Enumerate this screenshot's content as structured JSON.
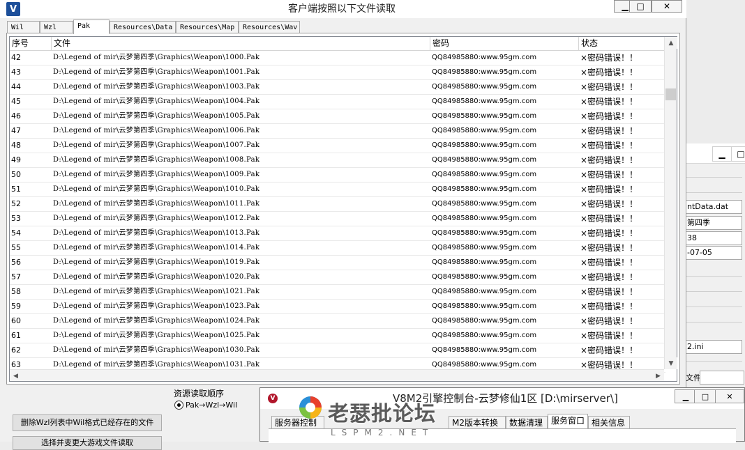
{
  "main_window": {
    "title": "客户端按照以下文件读取",
    "app_icon": "V",
    "controls": {
      "minimize": "▁",
      "maximize": "□",
      "close": "✕"
    }
  },
  "tabs": [
    {
      "label": "Wil"
    },
    {
      "label": "Wzl"
    },
    {
      "label": "Pak",
      "active": true
    },
    {
      "label": "Resources\\Data"
    },
    {
      "label": "Resources\\Map"
    },
    {
      "label": "Resources\\Wav"
    }
  ],
  "table": {
    "columns": [
      "序号",
      "文件",
      "密码",
      "状态"
    ],
    "rows": [
      {
        "no": "42",
        "file": "D:\\Legend of mir\\云梦第四季\\Graphics\\Weapon\\1000.Pak",
        "password": "QQ84985880:www.95gm.com",
        "status": "×密码错误！！"
      },
      {
        "no": "43",
        "file": "D:\\Legend of mir\\云梦第四季\\Graphics\\Weapon\\1001.Pak",
        "password": "QQ84985880:www.95gm.com",
        "status": "×密码错误！！"
      },
      {
        "no": "44",
        "file": "D:\\Legend of mir\\云梦第四季\\Graphics\\Weapon\\1003.Pak",
        "password": "QQ84985880:www.95gm.com",
        "status": "×密码错误！！"
      },
      {
        "no": "45",
        "file": "D:\\Legend of mir\\云梦第四季\\Graphics\\Weapon\\1004.Pak",
        "password": "QQ84985880:www.95gm.com",
        "status": "×密码错误！！"
      },
      {
        "no": "46",
        "file": "D:\\Legend of mir\\云梦第四季\\Graphics\\Weapon\\1005.Pak",
        "password": "QQ84985880:www.95gm.com",
        "status": "×密码错误！！"
      },
      {
        "no": "47",
        "file": "D:\\Legend of mir\\云梦第四季\\Graphics\\Weapon\\1006.Pak",
        "password": "QQ84985880:www.95gm.com",
        "status": "×密码错误！！"
      },
      {
        "no": "48",
        "file": "D:\\Legend of mir\\云梦第四季\\Graphics\\Weapon\\1007.Pak",
        "password": "QQ84985880:www.95gm.com",
        "status": "×密码错误！！"
      },
      {
        "no": "49",
        "file": "D:\\Legend of mir\\云梦第四季\\Graphics\\Weapon\\1008.Pak",
        "password": "QQ84985880:www.95gm.com",
        "status": "×密码错误！！"
      },
      {
        "no": "50",
        "file": "D:\\Legend of mir\\云梦第四季\\Graphics\\Weapon\\1009.Pak",
        "password": "QQ84985880:www.95gm.com",
        "status": "×密码错误！！"
      },
      {
        "no": "51",
        "file": "D:\\Legend of mir\\云梦第四季\\Graphics\\Weapon\\1010.Pak",
        "password": "QQ84985880:www.95gm.com",
        "status": "×密码错误！！"
      },
      {
        "no": "52",
        "file": "D:\\Legend of mir\\云梦第四季\\Graphics\\Weapon\\1011.Pak",
        "password": "QQ84985880:www.95gm.com",
        "status": "×密码错误！！"
      },
      {
        "no": "53",
        "file": "D:\\Legend of mir\\云梦第四季\\Graphics\\Weapon\\1012.Pak",
        "password": "QQ84985880:www.95gm.com",
        "status": "×密码错误！！"
      },
      {
        "no": "54",
        "file": "D:\\Legend of mir\\云梦第四季\\Graphics\\Weapon\\1013.Pak",
        "password": "QQ84985880:www.95gm.com",
        "status": "×密码错误！！"
      },
      {
        "no": "55",
        "file": "D:\\Legend of mir\\云梦第四季\\Graphics\\Weapon\\1014.Pak",
        "password": "QQ84985880:www.95gm.com",
        "status": "×密码错误！！"
      },
      {
        "no": "56",
        "file": "D:\\Legend of mir\\云梦第四季\\Graphics\\Weapon\\1019.Pak",
        "password": "QQ84985880:www.95gm.com",
        "status": "×密码错误！！"
      },
      {
        "no": "57",
        "file": "D:\\Legend of mir\\云梦第四季\\Graphics\\Weapon\\1020.Pak",
        "password": "QQ84985880:www.95gm.com",
        "status": "×密码错误！！"
      },
      {
        "no": "58",
        "file": "D:\\Legend of mir\\云梦第四季\\Graphics\\Weapon\\1021.Pak",
        "password": "QQ84985880:www.95gm.com",
        "status": "×密码错误！！"
      },
      {
        "no": "59",
        "file": "D:\\Legend of mir\\云梦第四季\\Graphics\\Weapon\\1023.Pak",
        "password": "QQ84985880:www.95gm.com",
        "status": "×密码错误！！"
      },
      {
        "no": "60",
        "file": "D:\\Legend of mir\\云梦第四季\\Graphics\\Weapon\\1024.Pak",
        "password": "QQ84985880:www.95gm.com",
        "status": "×密码错误！！"
      },
      {
        "no": "61",
        "file": "D:\\Legend of mir\\云梦第四季\\Graphics\\Weapon\\1025.Pak",
        "password": "QQ84985880:www.95gm.com",
        "status": "×密码错误！！"
      },
      {
        "no": "62",
        "file": "D:\\Legend of mir\\云梦第四季\\Graphics\\Weapon\\1030.Pak",
        "password": "QQ84985880:www.95gm.com",
        "status": "×密码错误！！"
      },
      {
        "no": "63",
        "file": "D:\\Legend of mir\\云梦第四季\\Graphics\\Weapon\\1031.Pak",
        "password": "QQ84985880:www.95gm.com",
        "status": "×密码错误！！"
      }
    ]
  },
  "scrollbar": {
    "up": "▲",
    "down": "▼",
    "left": "◀",
    "right": "▶"
  },
  "bottom": {
    "delete_button": "删除Wzl列表中Wil格式已经存在的文件",
    "second_button": "选择并变更大游戏文件读取",
    "order_group_label": "资源读取顺序",
    "order_option": "Pak→Wzl→Wil"
  },
  "background_window": {
    "controls": {
      "minimize": "▁",
      "maximize": "□"
    },
    "fields": [
      "ntData.dat",
      "第四季",
      "38",
      "-07-05",
      "2.ini"
    ],
    "file_label": "文件"
  },
  "console_window": {
    "title": "V8M2引擎控制台-云梦修仙1区 [D:\\mirserver\\]",
    "icon": "V",
    "controls": {
      "minimize": "▁",
      "maximize": "□",
      "close": "✕"
    },
    "tabs": [
      {
        "label": "服务器控制"
      },
      {
        "label": "M2版本转换"
      },
      {
        "label": "数据清理"
      },
      {
        "label": "服务窗口",
        "active": true
      },
      {
        "label": "相关信息"
      }
    ]
  },
  "watermark": {
    "text": "老瑟批论坛",
    "subtext": "LSPM2.NET"
  },
  "colors": {
    "app_icon": "#1d4f9a",
    "console_icon": "#b1162b"
  }
}
